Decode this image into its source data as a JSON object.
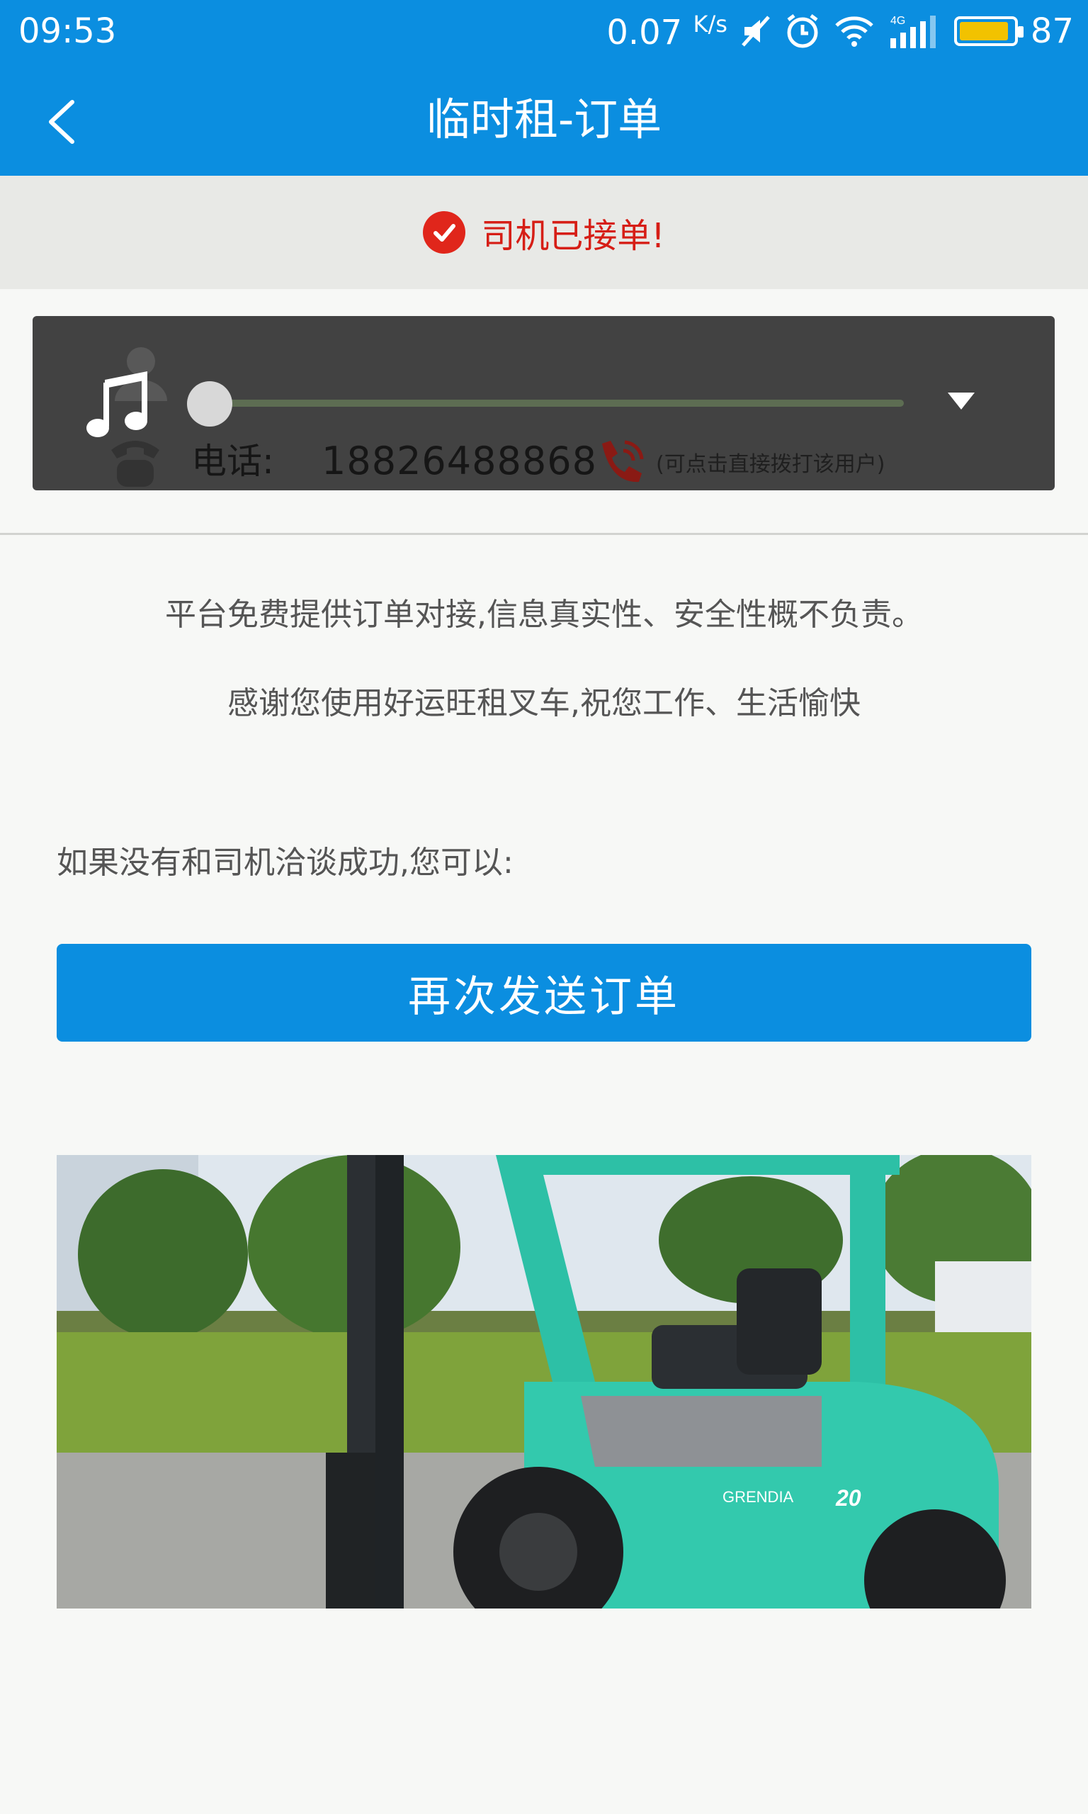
{
  "status_bar": {
    "time": "09:53",
    "speed": "0.07",
    "speed_unit": "K/s",
    "network": "4G",
    "battery": "87",
    "battery_level": 0.87
  },
  "header": {
    "title": "临时租-订单",
    "back_icon": "chevron-left-icon"
  },
  "notice": {
    "text": "司机已接单!",
    "icon": "check-circle-icon",
    "color": "#d61e16"
  },
  "player": {
    "phone_label": "电话:",
    "phone_number": "18826488868",
    "call_hint": "(可点击直接拨打该用户)",
    "progress": 0,
    "icons": [
      "music-note-icon",
      "dropdown-arrow-icon",
      "phone-call-icon"
    ]
  },
  "info": {
    "line1": "平台免费提供订单对接,信息真实性、安全性概不负责。",
    "line2": "感谢您使用好运旺租叉车,祝您工作、生活愉快"
  },
  "fallback": {
    "prompt": "如果没有和司机洽谈成功,您可以:",
    "button": "再次发送订单"
  },
  "photo": {
    "forklift_text": "GRENDIA",
    "forklift_model": "20"
  },
  "colors": {
    "primary": "#0b8ee0",
    "alert_red": "#d61e16",
    "player_bg": "#424242"
  }
}
